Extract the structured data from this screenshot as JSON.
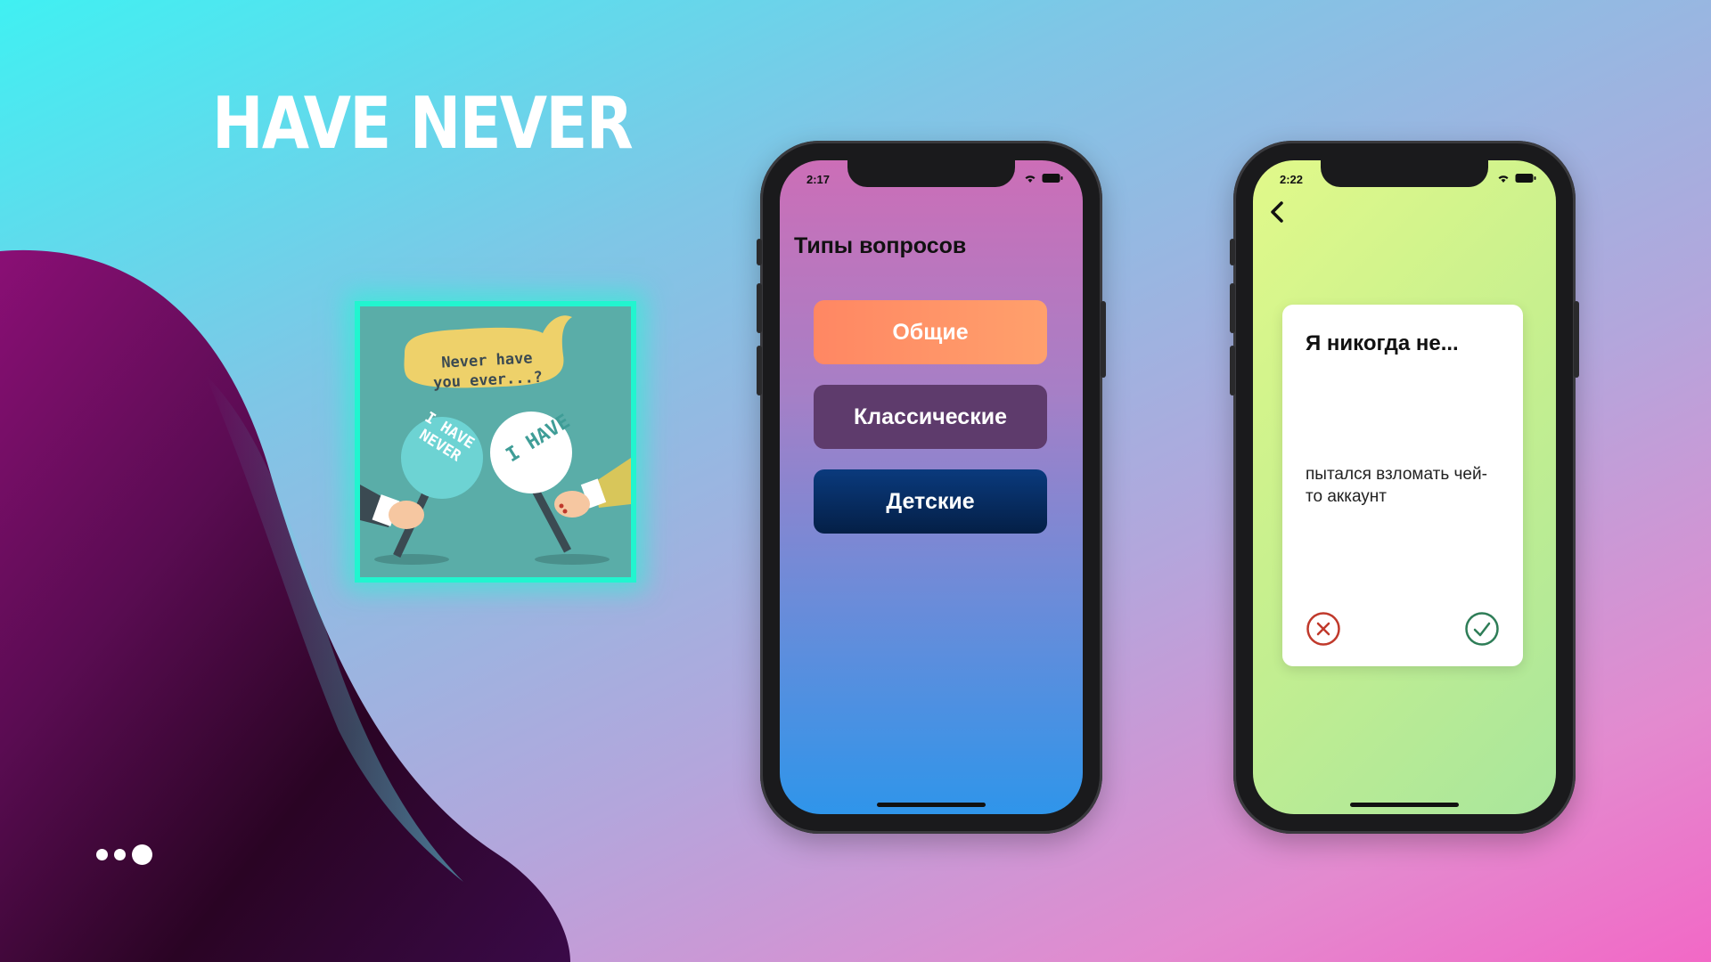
{
  "headline": "HAVE NEVER",
  "app_icon": {
    "bubble_line1": "Never have",
    "bubble_line2": "you ever...?",
    "sign_never_line1": "I HAVE",
    "sign_never_line2": "NEVER",
    "sign_have": "I HAVE"
  },
  "phone_categories": {
    "status_time": "2:17",
    "title": "Типы вопросов",
    "buttons": [
      {
        "label": "Общие"
      },
      {
        "label": "Классические"
      },
      {
        "label": "Детские"
      }
    ]
  },
  "phone_question": {
    "status_time": "2:22",
    "card": {
      "title": "Я никогда не...",
      "question": "пытался взломать чей-то аккаунт"
    }
  },
  "colors": {
    "accent_glow": "#21f5cf",
    "reject": "#c0392b",
    "accept": "#2e7d57"
  }
}
